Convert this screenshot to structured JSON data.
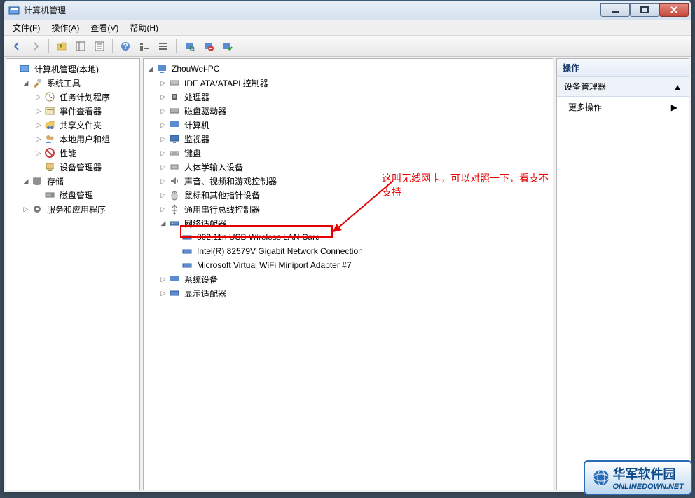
{
  "window": {
    "title": "计算机管理"
  },
  "menus": [
    "文件(F)",
    "操作(A)",
    "查看(V)",
    "帮助(H)"
  ],
  "left_tree": {
    "root": "计算机管理(本地)",
    "sys_tools": "系统工具",
    "task_sched": "任务计划程序",
    "event_viewer": "事件查看器",
    "shared": "共享文件夹",
    "users": "本地用户和组",
    "perf": "性能",
    "devmgr": "设备管理器",
    "storage": "存储",
    "diskmgr": "磁盘管理",
    "services": "服务和应用程序"
  },
  "device_tree": {
    "root": "ZhouWei-PC",
    "ide": "IDE ATA/ATAPI 控制器",
    "cpu": "处理器",
    "disk": "磁盘驱动器",
    "computer": "计算机",
    "monitor": "监视器",
    "keyboard": "键盘",
    "hid": "人体学输入设备",
    "sound": "声音、视频和游戏控制器",
    "mouse": "鼠标和其他指针设备",
    "usb": "通用串行总线控制器",
    "net": "网络适配器",
    "net1": "802.11n USB Wireless LAN Card",
    "net2": "Intel(R) 82579V Gigabit Network Connection",
    "net3": "Microsoft Virtual WiFi Miniport Adapter #7",
    "sysdev": "系统设备",
    "display": "显示适配器"
  },
  "actions": {
    "header": "操作",
    "section": "设备管理器",
    "more": "更多操作"
  },
  "annotation_text": "这叫无线网卡，可以对照一下，看支不支持",
  "watermark": {
    "cn": "华军软件园",
    "en": "ONLINEDOWN.NET"
  }
}
